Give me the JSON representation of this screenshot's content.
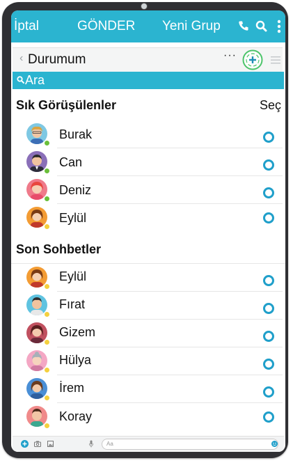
{
  "topbar": {
    "cancel_label": "İptal",
    "send_label": "GÖNDER",
    "new_group_label": "Yeni Grup"
  },
  "subbar": {
    "title": "Durumum",
    "dots": "···"
  },
  "search": {
    "placeholder": "Ara"
  },
  "frequent": {
    "header": "Sık Görüşülenler",
    "select_label": "Seç",
    "contacts": [
      {
        "name": "Burak"
      },
      {
        "name": "Can"
      },
      {
        "name": "Deniz"
      },
      {
        "name": "Eylül"
      }
    ]
  },
  "recent": {
    "header": "Son Sohbetler",
    "contacts": [
      {
        "name": "Eylül"
      },
      {
        "name": "Fırat"
      },
      {
        "name": "Gizem"
      },
      {
        "name": "Hülya"
      },
      {
        "name": "İrem"
      },
      {
        "name": "Koray"
      }
    ]
  },
  "composer": {
    "placeholder": "Aa"
  },
  "colors": {
    "accent": "#2bb4d0",
    "radio": "#1f9fca",
    "online": "#6abf3a",
    "away": "#f4d03f"
  }
}
